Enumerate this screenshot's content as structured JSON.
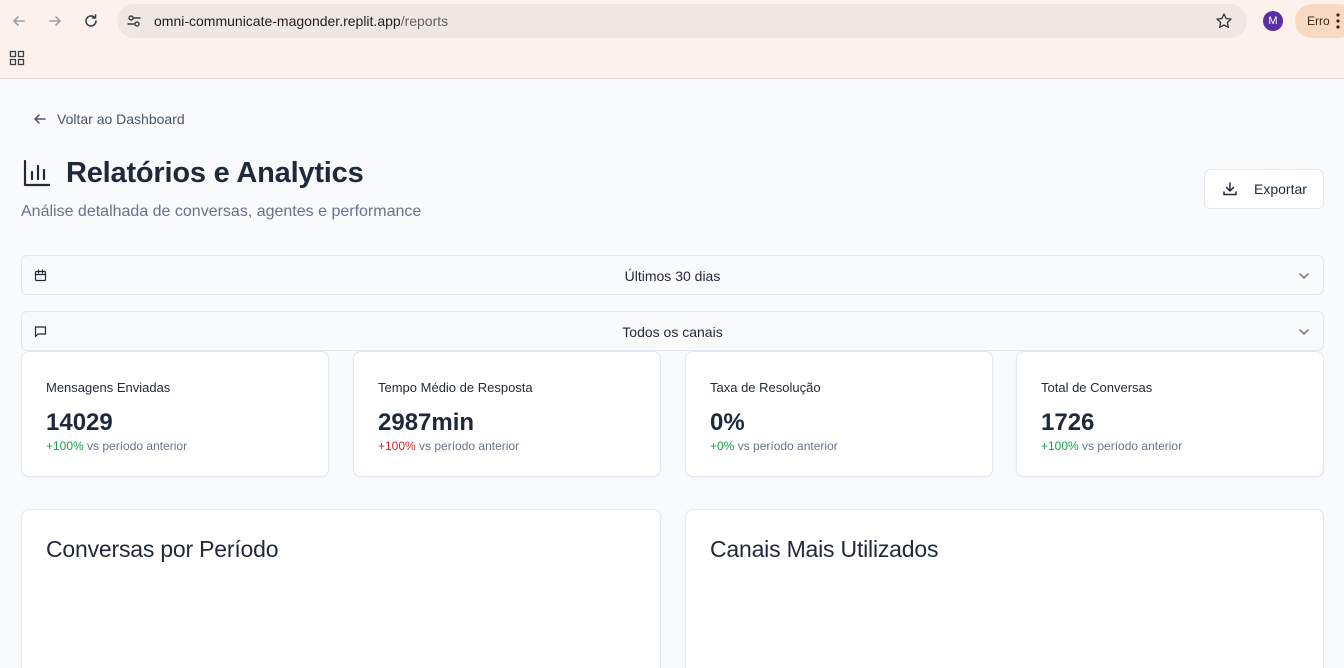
{
  "browser": {
    "url_host": "omni-communicate-magonder.replit.app",
    "url_path": "/reports",
    "profile_initial": "M",
    "error_label": "Erro"
  },
  "page": {
    "back_label": "Voltar ao Dashboard",
    "title": "Relatórios e Analytics",
    "subtitle": "Análise detalhada de conversas, agentes e performance",
    "export_label": "Exportar"
  },
  "filters": {
    "period": "Últimos 30 dias",
    "channel": "Todos os canais"
  },
  "stats": [
    {
      "label": "Mensagens Enviadas",
      "value": "14029",
      "change": "+100%",
      "suffix": " vs período anterior",
      "change_color": "#16a34a"
    },
    {
      "label": "Tempo Médio de Resposta",
      "value": "2987min",
      "change": "+100%",
      "suffix": " vs período anterior",
      "change_color": "#dc2626"
    },
    {
      "label": "Taxa de Resolução",
      "value": "0%",
      "change": "+0%",
      "suffix": " vs período anterior",
      "change_color": "#16a34a"
    },
    {
      "label": "Total de Conversas",
      "value": "1726",
      "change": "+100%",
      "suffix": " vs período anterior",
      "change_color": "#16a34a"
    }
  ],
  "charts": {
    "left_title": "Conversas por Período",
    "right_title": "Canais Mais Utilizados"
  },
  "icons": {
    "back": "arrow-left-icon",
    "forward": "arrow-right-icon",
    "reload": "reload-icon",
    "site_settings": "tune-icon",
    "bookmark": "star-icon",
    "apps": "apps-grid-icon",
    "title": "bar-chart-icon",
    "export": "download-icon",
    "calendar": "calendar-icon",
    "message": "message-square-icon",
    "dropdown": "chevron-down-icon"
  }
}
